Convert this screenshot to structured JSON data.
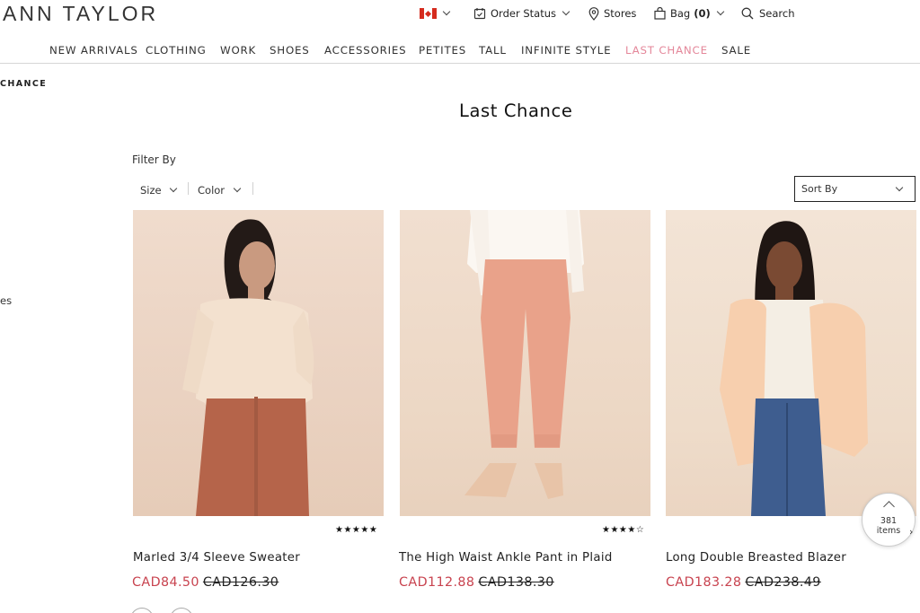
{
  "brand": {
    "logo": "ANN TAYLOR"
  },
  "utility": {
    "order_status": "Order Status",
    "stores": "Stores",
    "bag_label": "Bag",
    "bag_count": "(0)",
    "search": "Search",
    "icons": [
      "canada-flag-icon",
      "order-status-icon",
      "location-pin-icon",
      "shopping-bag-icon",
      "search-icon"
    ]
  },
  "nav": {
    "items": [
      "NEW ARRIVALS",
      "CLOTHING",
      "WORK",
      "SHOES",
      "ACCESSORIES",
      "PETITES",
      "TALL",
      "INFINITE STYLE",
      "LAST CHANCE",
      "SALE"
    ],
    "active": "LAST CHANCE",
    "active_color": "#e4879a"
  },
  "sidebar": {
    "breadcrumb": "CHANCE",
    "fragment": "es"
  },
  "page": {
    "title": "Last Chance"
  },
  "filters": {
    "filter_by": "Filter By",
    "size": "Size",
    "color": "Color",
    "sort_by": "Sort By"
  },
  "products": [
    {
      "name": "Marled 3/4 Sleeve Sweater",
      "sale_price": "CAD84.50",
      "orig_price": "CAD126.30",
      "rating": 5,
      "stars": "★★★★★"
    },
    {
      "name": "The High Waist Ankle Pant in Plaid",
      "sale_price": "CAD112.88",
      "orig_price": "CAD138.30",
      "rating": 4,
      "stars": "★★★★☆"
    },
    {
      "name": "Long Double Breasted Blazer",
      "sale_price": "CAD183.28",
      "orig_price": "CAD238.49",
      "rating": null,
      "stars": ""
    }
  ],
  "results": {
    "count": "381",
    "unit": "items"
  },
  "colors": {
    "sale": "#c8434f",
    "accent_pink": "#e4879a"
  }
}
